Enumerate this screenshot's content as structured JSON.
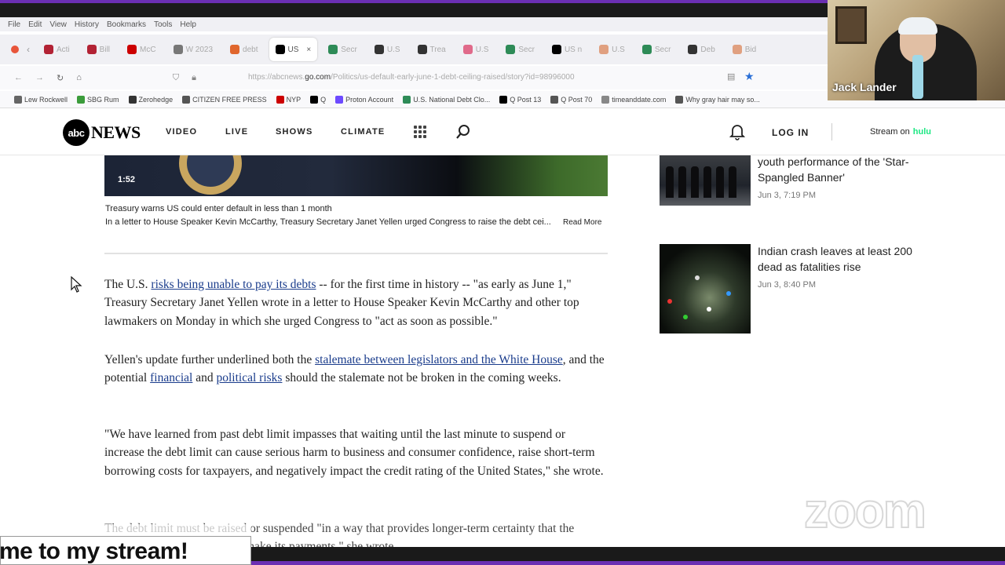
{
  "browser": {
    "menu": [
      "File",
      "Edit",
      "View",
      "History",
      "Bookmarks",
      "Tools",
      "Help"
    ],
    "tabs": [
      {
        "label": "Acti",
        "color": "#b22234"
      },
      {
        "label": "Bill",
        "color": "#b22234"
      },
      {
        "label": "McC",
        "color": "#cc0000"
      },
      {
        "label": "W 2023",
        "color": "#777777"
      },
      {
        "label": "debt",
        "color": "#e0662d"
      },
      {
        "label": "US",
        "color": "#000000",
        "active": true
      },
      {
        "label": "Secr",
        "color": "#2e8b57"
      },
      {
        "label": "U.S",
        "color": "#333333"
      },
      {
        "label": "Trea",
        "color": "#333333"
      },
      {
        "label": "U.S",
        "color": "#e06a8a"
      },
      {
        "label": "Secr",
        "color": "#2e8b57"
      },
      {
        "label": "US n",
        "color": "#000000"
      },
      {
        "label": "U.S",
        "color": "#e0a080"
      },
      {
        "label": "Secr",
        "color": "#2e8b57"
      },
      {
        "label": "Deb",
        "color": "#333333"
      },
      {
        "label": "Bid",
        "color": "#e0a080"
      }
    ],
    "url_prefix": "https://abcnews.",
    "url_domain": "go.com",
    "url_path": "/Politics/us-default-early-june-1-debt-ceiling-raised/story?id=98996000",
    "bookmarks": [
      {
        "label": "Lew Rockwell",
        "color": "#666666"
      },
      {
        "label": "SBG Rum",
        "color": "#3b9c3b"
      },
      {
        "label": "Zerohedge",
        "color": "#333333"
      },
      {
        "label": "CITIZEN FREE PRESS",
        "color": "#555555"
      },
      {
        "label": "NYP",
        "color": "#cc0000"
      },
      {
        "label": "Q",
        "color": "#000000"
      },
      {
        "label": "Proton Account",
        "color": "#6d4aff"
      },
      {
        "label": "U.S. National Debt Clo...",
        "color": "#2e8b57"
      },
      {
        "label": "Q Post 13",
        "color": "#000000"
      },
      {
        "label": "Q Post 70",
        "color": "#555555"
      },
      {
        "label": "timeanddate.com",
        "color": "#888888"
      },
      {
        "label": "Why gray hair may so...",
        "color": "#555555"
      }
    ]
  },
  "webcam": {
    "name": "Jack Lander"
  },
  "site": {
    "logo_abc": "abc",
    "logo_news": "NEWS",
    "nav": [
      "VIDEO",
      "LIVE",
      "SHOWS",
      "CLIMATE"
    ],
    "login": "LOG IN",
    "stream_text": "Stream on",
    "stream_brand": "hulu"
  },
  "article": {
    "video_duration": "1:52",
    "caption_title": "Treasury warns US could enter default in less than 1 month",
    "caption_body": "In a letter to House Speaker Kevin McCarthy, Treasury Secretary Janet Yellen urged Congress to raise the debt cei...",
    "read_more": "Read More",
    "p1_a": "The U.S. ",
    "p1_link": "risks being unable to pay its debts",
    "p1_b": " -- for the first time in history -- \"as early as June 1,\" Treasury Secretary Janet Yellen wrote in a letter to House Speaker Kevin McCarthy and other top lawmakers on Monday in which she urged Congress to \"act as soon as possible.\"",
    "p2_a": "Yellen's update further underlined both the ",
    "p2_link1": "stalemate between legislators and the White House",
    "p2_b": ", and the potential ",
    "p2_link2": "financial",
    "p2_c": " and ",
    "p2_link3": "political risks",
    "p2_d": " should the stalemate not be broken in the coming weeks.",
    "p3": "\"We have learned from past debt limit impasses that waiting until the last minute to suspend or increase the debt limit can cause serious harm to business and consumer confidence, raise short-term borrowing costs for taxpayers, and negatively impact the credit rating of the United States,\" she wrote.",
    "p4": "The debt limit must be raised or suspended \"in a way that provides longer-term certainty that the government will continue to make its payments,\" she wrote."
  },
  "sidebar": [
    {
      "title": "youth performance of the 'Star-Spangled Banner'",
      "time": "Jun 3, 7:19 PM"
    },
    {
      "title": "Indian crash leaves at least 200 dead as fatalities rise",
      "time": "Jun 3, 8:40 PM"
    }
  ],
  "overlay": {
    "zoom_watermark": "zoom",
    "ticker": "me to my stream!"
  }
}
